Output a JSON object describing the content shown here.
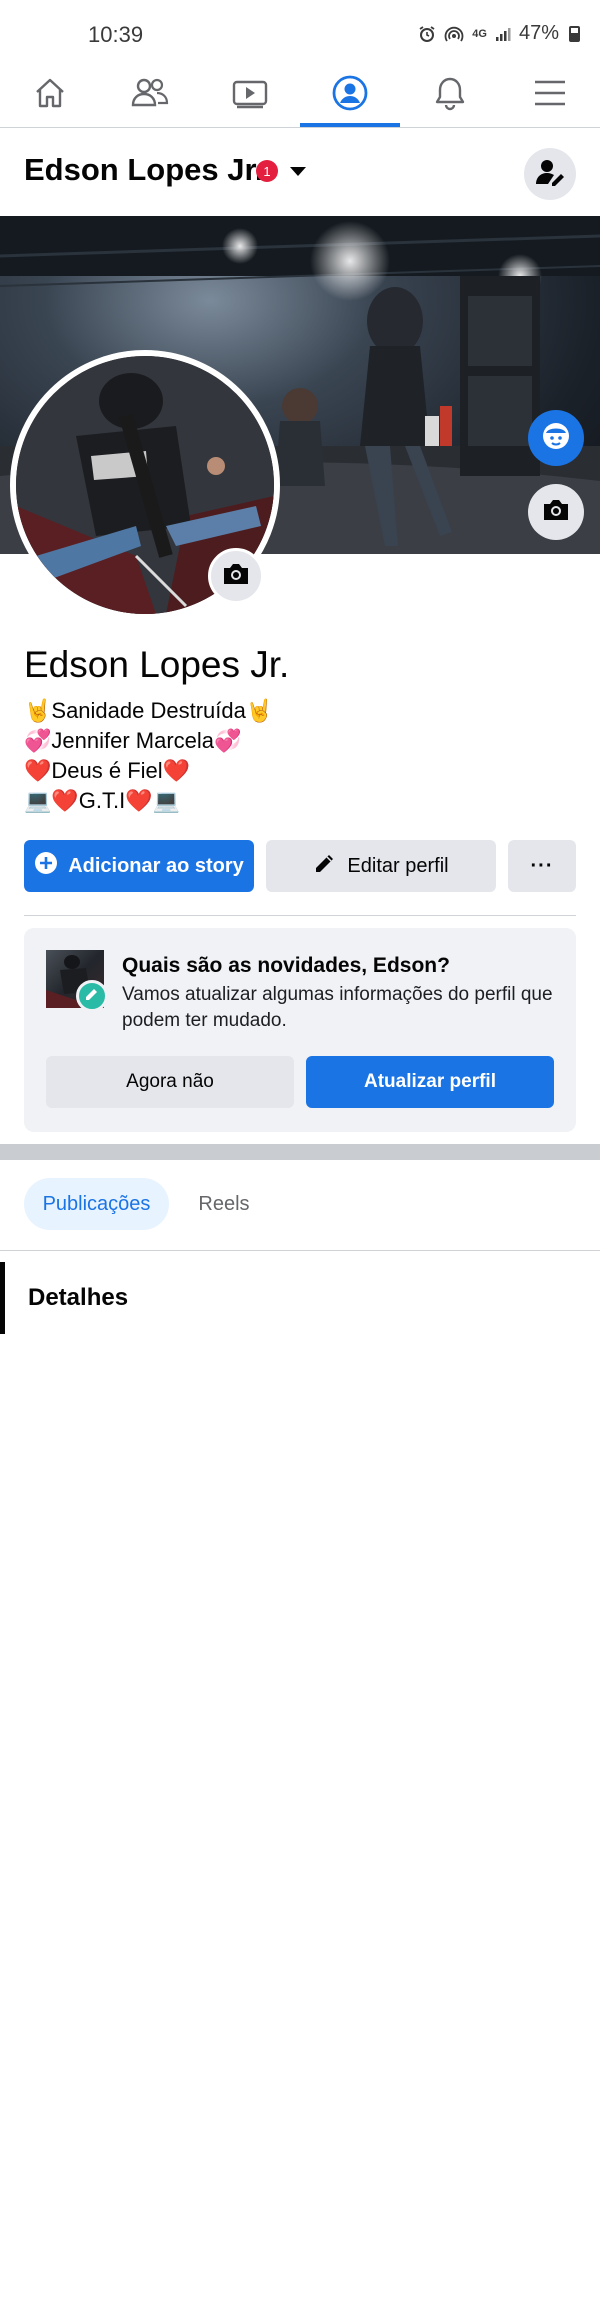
{
  "status": {
    "time": "10:39",
    "network": "4G",
    "battery": "47%"
  },
  "nav": {
    "tabs": [
      {
        "name": "home",
        "icon": "home-icon"
      },
      {
        "name": "friends",
        "icon": "friends-icon"
      },
      {
        "name": "watch",
        "icon": "video-icon"
      },
      {
        "name": "profile",
        "icon": "profile-icon",
        "active": true
      },
      {
        "name": "notifications",
        "icon": "bell-icon"
      },
      {
        "name": "menu",
        "icon": "menu-icon"
      }
    ]
  },
  "header": {
    "name": "Edson Lopes Jr.",
    "badge_count": "1"
  },
  "profile": {
    "name": "Edson Lopes Jr.",
    "bio": [
      "🤘Sanidade Destruída🤘",
      "💞Jennifer Marcela💞",
      "❤️Deus é Fiel❤️",
      "💻❤️G.T.I❤️💻"
    ]
  },
  "actions": {
    "add_story": "Adicionar ao story",
    "edit_profile": "Editar perfil",
    "more": "···"
  },
  "update_card": {
    "title": "Quais são as novidades, Edson?",
    "text": "Vamos atualizar algumas informações do perfil que podem ter mudado.",
    "dismiss": "Agora não",
    "update": "Atualizar perfil"
  },
  "tabs": {
    "posts": "Publicações",
    "reels": "Reels"
  },
  "details": {
    "title": "Detalhes"
  },
  "colors": {
    "accent": "#1b74e4",
    "badge": "#e41e3f",
    "card_bg": "#f0f2f5",
    "button_gray": "#e4e6eb"
  }
}
